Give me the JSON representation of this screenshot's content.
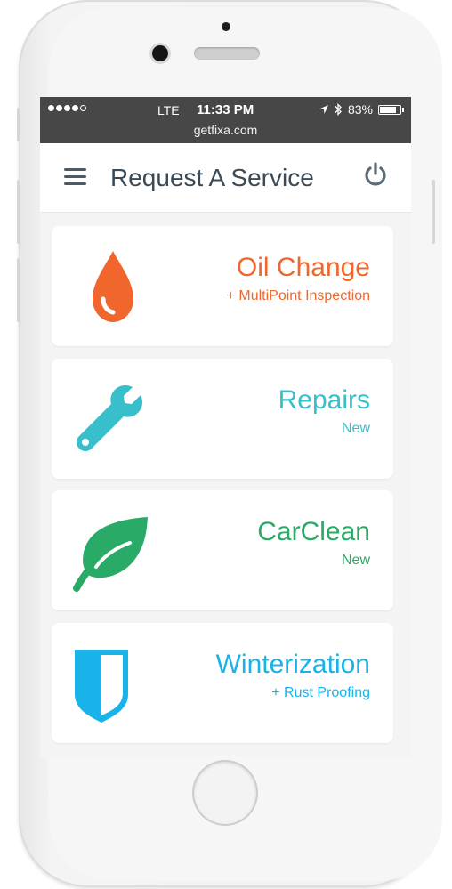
{
  "status_bar": {
    "carrier": "LTE",
    "time": "11:33 PM",
    "battery_percent": "83%",
    "battery_level": 0.83,
    "signal_bars_filled": 4,
    "signal_bars_total": 5,
    "url": "getfixa.com"
  },
  "header": {
    "title": "Request A Service",
    "menu_icon": "hamburger-menu-icon",
    "power_icon": "power-icon"
  },
  "services": [
    {
      "title": "Oil Change",
      "subtitle": "+ MultiPoint Inspection",
      "icon": "oil-drop-icon",
      "color": "#f0662c"
    },
    {
      "title": "Repairs",
      "subtitle": "New",
      "icon": "wrench-icon",
      "color": "#38bfcc"
    },
    {
      "title": "CarClean",
      "subtitle": "New",
      "icon": "leaf-icon",
      "color": "#2aaa67"
    },
    {
      "title": "Winterization",
      "subtitle": "+ Rust Proofing",
      "icon": "shield-icon",
      "color": "#19b3ea"
    }
  ]
}
